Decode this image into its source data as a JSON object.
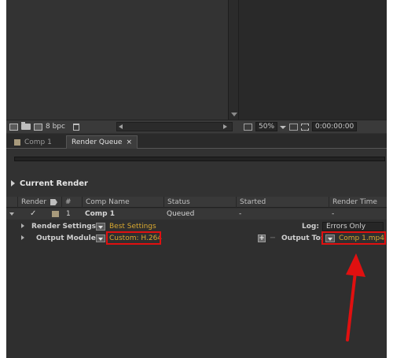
{
  "project_panel": {
    "toolbar": {
      "bit_depth": "8 bpc"
    }
  },
  "viewer": {
    "zoom": "50%",
    "timecode": "0:00:00:00"
  },
  "tabs": [
    {
      "label": "Comp 1",
      "active": false
    },
    {
      "label": "Render Queue",
      "active": true,
      "close": "×"
    }
  ],
  "current_render": {
    "label": "Current Render"
  },
  "queue": {
    "columns": {
      "render": "Render",
      "number": "#",
      "comp_name": "Comp Name",
      "status": "Status",
      "started": "Started",
      "render_time": "Render Time"
    },
    "item": {
      "check": "✓",
      "number": "1",
      "comp_name": "Comp 1",
      "status": "Queued",
      "started": "-",
      "render_time": "-"
    },
    "render_settings": {
      "label": "Render Settings:",
      "value": "Best Settings",
      "log_label": "Log:",
      "log_value": "Errors Only"
    },
    "output_module": {
      "label": "Output Module:",
      "value": "Custom: H.264",
      "plus": "+",
      "minus": "−",
      "output_to_label": "Output To:",
      "output_to_value": "Comp 1.mp4"
    }
  },
  "colors": {
    "link": "#d8a830",
    "highlight": "#e01010",
    "comp_label": "#a89a7c"
  }
}
